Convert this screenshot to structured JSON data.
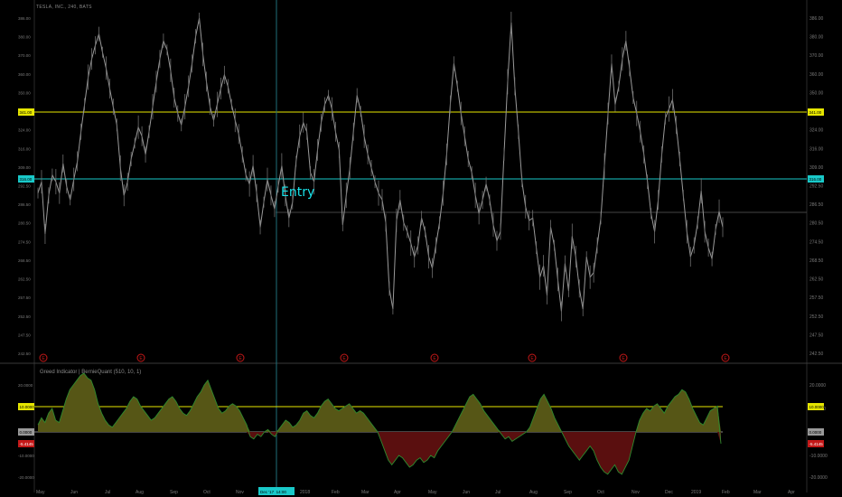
{
  "header": {
    "symbol": "TESLA, INC., 240, BATS"
  },
  "annotation": {
    "entry_label": "Entry"
  },
  "indicator": {
    "title": "Greed Indicator | BernieQuant (510, 10, 1)"
  },
  "colors": {
    "background": "#000000",
    "price_line": "#9a9a9a",
    "yellow_level": "#e6e600",
    "cyan_level": "#19c9c9",
    "greed_fill": "#565616",
    "greed_line": "#2e8a2e",
    "fear_fill": "#5a0f0f",
    "fear_line": "#a01818",
    "earnings_marker": "#c41818"
  },
  "chart_data": [
    {
      "type": "line",
      "title": "TESLA, INC., 240, BATS",
      "x_ticks": [
        "May",
        "Jun",
        "Jul",
        "Aug",
        "Sep",
        "Oct",
        "Nov",
        "Dec '17",
        "2018",
        "Feb",
        "Mar",
        "Apr",
        "May",
        "Jun",
        "Jul",
        "Aug",
        "Sep",
        "Oct",
        "Nov",
        "Dec",
        "2019",
        "Feb",
        "Mar",
        "Apr"
      ],
      "crosshair_x_label": "Dec '17",
      "crosshair_x_time": "14:00",
      "y_ticks": [
        "386.00",
        "380.00",
        "370.00",
        "360.00",
        "350.00",
        "332.00",
        "324.00",
        "316.00",
        "309.00",
        "292.50",
        "286.50",
        "280.50",
        "274.50",
        "268.50",
        "262.50",
        "257.50",
        "252.50",
        "247.50",
        "242.50"
      ],
      "price_levels": [
        {
          "label": "341.00",
          "value": 341.0,
          "color": "yellow"
        },
        {
          "label": "316.00",
          "value": 316.0,
          "color": "cyan"
        }
      ],
      "series": [
        {
          "x": [
            0,
            1,
            2,
            3,
            4,
            5,
            6,
            7,
            8,
            9,
            10,
            11,
            12,
            13,
            14,
            15,
            16,
            17,
            18,
            19,
            20,
            21,
            22,
            23,
            24,
            25,
            26,
            27,
            28,
            29,
            30,
            31,
            32,
            33,
            34,
            35,
            36,
            37,
            38,
            39,
            40,
            41,
            42,
            43,
            44,
            45,
            46,
            47,
            48,
            49,
            50,
            51,
            52,
            53,
            54,
            55,
            56,
            57,
            58,
            59,
            60,
            61,
            62,
            63,
            64,
            65,
            66,
            67,
            68,
            69,
            70,
            71,
            72,
            73,
            74,
            75,
            76,
            77,
            78,
            79,
            80,
            81,
            82,
            83,
            84,
            85,
            86,
            87,
            88,
            89,
            90,
            91,
            92,
            93,
            94,
            95,
            96,
            97,
            98,
            99,
            100,
            101,
            102,
            103,
            104,
            105,
            106,
            107,
            108,
            109,
            110,
            111,
            112,
            113,
            114,
            115,
            116,
            117,
            118,
            119,
            120,
            121,
            122,
            123,
            124,
            125,
            126,
            127,
            128,
            129,
            130,
            131,
            132,
            133,
            134,
            135,
            136,
            137,
            138,
            139,
            140,
            141,
            142,
            143,
            144,
            145,
            146,
            147,
            148,
            149,
            150,
            151,
            152,
            153,
            154,
            155,
            156,
            157,
            158,
            159,
            160,
            161,
            162,
            163,
            164,
            165,
            166,
            167,
            168,
            169,
            170,
            171,
            172,
            173,
            174,
            175,
            176,
            177,
            178,
            179,
            180,
            181,
            182,
            183,
            184,
            185,
            186,
            187,
            188,
            189,
            190,
            191
          ],
          "values": [
            313,
            318,
            295,
            312,
            321,
            318,
            313,
            326,
            316,
            310,
            319,
            327,
            340,
            352,
            364,
            372,
            378,
            383,
            375,
            368,
            359,
            351,
            343,
            324,
            312,
            318,
            328,
            335,
            342,
            338,
            330,
            340,
            351,
            362,
            372,
            380,
            376,
            367,
            355,
            348,
            343,
            351,
            360,
            370,
            382,
            390,
            374,
            362,
            351,
            345,
            352,
            359,
            365,
            360,
            352,
            345,
            339,
            330,
            321,
            317,
            325,
            313,
            298,
            309,
            319,
            312,
            306,
            316,
            325,
            312,
            302,
            309,
            327,
            338,
            344,
            340,
            322,
            318,
            332,
            344,
            352,
            356,
            350,
            340,
            332,
            299,
            312,
            324,
            340,
            356,
            349,
            338,
            330,
            324,
            318,
            313,
            310,
            300,
            271,
            262,
            301,
            310,
            300,
            296,
            291,
            285,
            290,
            302,
            296,
            285,
            280,
            290,
            300,
            313,
            330,
            352,
            370,
            360,
            348,
            338,
            328,
            322,
            312,
            304,
            310,
            317,
            310,
            299,
            292,
            296,
            330,
            362,
            388,
            360,
            340,
            318,
            307,
            301,
            302,
            289,
            276,
            281,
            268,
            298,
            290,
            275,
            261,
            282,
            270,
            294,
            285,
            271,
            262,
            285,
            276,
            278,
            290,
            302,
            325,
            348,
            370,
            352,
            360,
            372,
            380,
            368,
            355,
            348,
            340,
            330,
            318,
            304,
            296,
            310,
            330,
            346,
            350,
            354,
            343,
            328,
            312,
            296,
            285,
            290,
            300,
            314,
            296,
            289,
            284,
            297,
            305,
            298
          ],
          "note": "approximate close prices"
        }
      ]
    },
    {
      "type": "area",
      "title": "Greed Indicator | BernieQuant (510, 10, 1)",
      "y_ticks": [
        "20.0000",
        "10.0000",
        "0.0000",
        "-10.0000",
        "-20.0000"
      ],
      "value_labels": [
        {
          "label": "10.0000",
          "value": 10.0,
          "color": "yellow"
        },
        {
          "label": "0.0000",
          "value": 0.0,
          "color": "gray"
        },
        {
          "label": "-5.4145",
          "value": -5.4145,
          "color": "red"
        }
      ],
      "ylim": [
        -20,
        20
      ],
      "series": [
        {
          "values": [
            3,
            6,
            4,
            8,
            10,
            5,
            4,
            9,
            14,
            18,
            20,
            22,
            24,
            25,
            23,
            22,
            18,
            12,
            8,
            5,
            3,
            2,
            4,
            6,
            8,
            10,
            13,
            15,
            14,
            11,
            9,
            7,
            5,
            6,
            8,
            10,
            12,
            14,
            15,
            13,
            10,
            8,
            7,
            9,
            12,
            15,
            17,
            20,
            22,
            18,
            14,
            10,
            8,
            9,
            11,
            12,
            11,
            9,
            6,
            3,
            -2,
            -3,
            -1,
            -2,
            0,
            1,
            -1,
            -2,
            1,
            3,
            5,
            4,
            2,
            3,
            5,
            8,
            9,
            7,
            6,
            8,
            11,
            13,
            14,
            12,
            10,
            9,
            10,
            11,
            12,
            10,
            8,
            9,
            8,
            6,
            4,
            2,
            0,
            -4,
            -8,
            -12,
            -14,
            -12,
            -10,
            -11,
            -13,
            -15,
            -14,
            -12,
            -11,
            -13,
            -12,
            -10,
            -11,
            -8,
            -6,
            -4,
            -2,
            0,
            3,
            6,
            9,
            12,
            15,
            16,
            14,
            12,
            9,
            7,
            5,
            3,
            1,
            -1,
            -3,
            -2,
            -4,
            -3,
            -2,
            -1,
            0,
            2,
            6,
            10,
            14,
            16,
            13,
            10,
            6,
            3,
            0,
            -3,
            -6,
            -8,
            -10,
            -12,
            -10,
            -8,
            -6,
            -8,
            -12,
            -15,
            -17,
            -18,
            -16,
            -14,
            -17,
            -18,
            -15,
            -12,
            -6,
            0,
            5,
            8,
            10,
            9,
            11,
            12,
            10,
            8,
            11,
            13,
            15,
            16,
            18,
            17,
            14,
            10,
            7,
            4,
            3,
            6,
            9,
            10,
            11,
            -5
          ]
        }
      ]
    }
  ],
  "earnings_markers": [
    "E",
    "E",
    "E",
    "E",
    "E",
    "E",
    "E",
    "E"
  ]
}
